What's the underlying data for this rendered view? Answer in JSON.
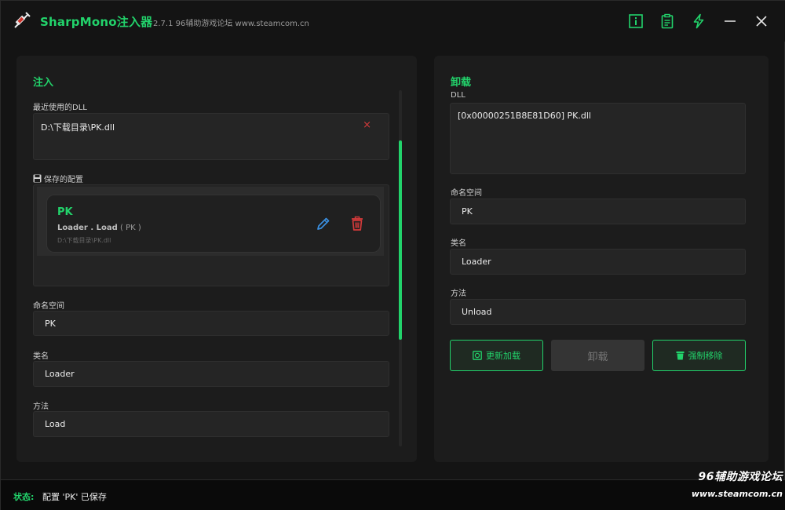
{
  "titlebar": {
    "app_name": "SharpMono注入器",
    "subtitle": "2.7.1 96辅助游戏论坛 www.steamcom.cn",
    "icons": [
      "syringe-logo-icon",
      "info-icon",
      "clipboard-icon",
      "lightning-icon",
      "minimize-icon",
      "close-icon"
    ]
  },
  "inject": {
    "title": "注入",
    "recent_dll_label": "最近使用的DLL",
    "recent_dll_path": "D:\\下载目录\\PK.dll",
    "remove_glyph": "×",
    "saved_label": "保存的配置",
    "saved_configs": [
      {
        "name": "PK",
        "class_part": "Loader",
        "method_part": "Load",
        "namespace_part": "PK",
        "path": "D:\\下载目录\\PK.dll"
      }
    ],
    "namespace_label": "命名空间",
    "namespace_value": "PK",
    "class_label": "类名",
    "class_value": "Loader",
    "method_label": "方法",
    "method_value": "Load"
  },
  "unload": {
    "title": "卸载",
    "dll_label": "DLL",
    "dll_value": "[0x00000251B8E81D60] PK.dll",
    "namespace_label": "命名空间",
    "namespace_value": "PK",
    "class_label": "类名",
    "class_value": "Loader",
    "method_label": "方法",
    "method_value": "Unload",
    "reload_button": "更新加载",
    "unload_button": "卸载",
    "force_remove_button": "强制移除"
  },
  "status": {
    "label": "状态:",
    "text": "配置 'PK' 已保存"
  },
  "watermark": {
    "line1": "96辅助游戏论坛",
    "line2": "www.steamcom.cn"
  },
  "colors": {
    "accent": "#22d36b",
    "danger": "#d33a3a",
    "edit": "#3a8fe0",
    "background": "#141414",
    "panel": "#1c1c1c",
    "input": "#252525"
  }
}
